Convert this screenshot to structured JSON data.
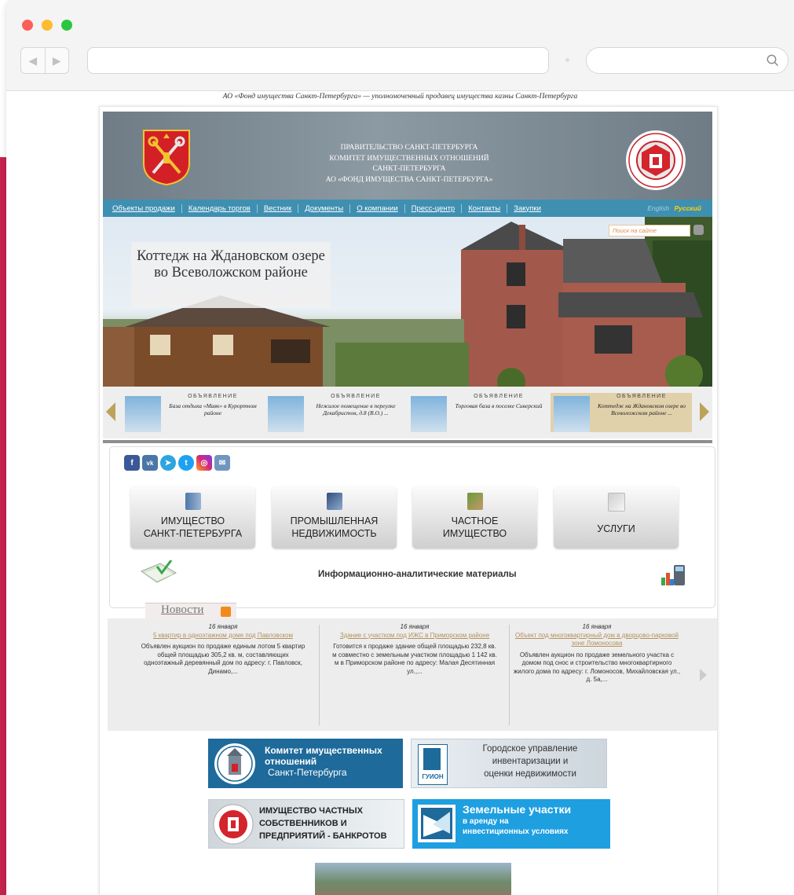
{
  "site": {
    "tagline": "АО «Фонд имущества Санкт-Петербурга» — уполномоченный продавец имущества казны Санкт-Петербурга",
    "header_lines": [
      "ПРАВИТЕЛЬСТВО САНКТ-ПЕТЕРБУРГА",
      "КОМИТЕТ ИМУЩЕСТВЕННЫХ ОТНОШЕНИЙ",
      "САНКТ-ПЕТЕРБУРГА",
      "АО «ФОНД ИМУЩЕСТВА САНКТ-ПЕТЕРБУРГА»"
    ]
  },
  "menu": {
    "items": [
      "Объекты продажи",
      "Календарь торгов",
      "Вестник",
      "Документы",
      "О компании",
      "Пресс-центр",
      "Контакты",
      "Закупки"
    ],
    "lang_en": "English",
    "lang_ru": "Русский"
  },
  "hero": {
    "title": "Коттедж на Ждановском озере во Всеволожском районе",
    "search_placeholder": "Поиск на сайте"
  },
  "carousel": {
    "label": "ОБЪЯВЛЕНИЕ",
    "items": [
      {
        "text": "База отдыха «Маяк» в Курортном районе"
      },
      {
        "text": "Нежилое помещение в переулке Декабристов, д.8 (В.О.) ..."
      },
      {
        "text": "Торговая база в поселке Сиверский"
      },
      {
        "text": "Коттедж на Ждановском озере во Всеволожском районе ..."
      }
    ]
  },
  "social": {
    "icons": [
      "facebook-icon",
      "vk-icon",
      "telegram-icon",
      "twitter-icon",
      "instagram-icon",
      "email-icon"
    ]
  },
  "tiles": [
    {
      "line1": "ИМУЩЕСТВО",
      "line2": "САНКТ-ПЕТЕРБУРГА"
    },
    {
      "line1": "ПРОМЫШЛЕННАЯ",
      "line2": "НЕДВИЖИМОСТЬ"
    },
    {
      "line1": "ЧАСТНОЕ",
      "line2": "ИМУЩЕСТВО"
    },
    {
      "line1": "УСЛУГИ",
      "line2": ""
    }
  ],
  "info": {
    "text": "Информационно-аналитические материалы"
  },
  "news": {
    "title": "Новости",
    "items": [
      {
        "date": "16 января",
        "headline": "5 квартир в одноэтажном доме под Павловском",
        "body": "Объявлен аукцион по продаже единым лотом 5 квартир общей площадью 305,2 кв. м, составляющих одноэтажный деревянный дом по адресу: г. Павловск, Динамо,..."
      },
      {
        "date": "16 января",
        "headline": "Здание с участком под ИЖС в Приморском районе",
        "body": "Готовится к продаже здание общей площадью 232,8 кв. м совместно с земельным участком площадью 1 142 кв. м в Приморском районе по адресу: Малая Десятинная ул.,..."
      },
      {
        "date": "16 января",
        "headline": "Объект под многоквартирный дом в дворцово-парковой зоне Ломоносова",
        "body": "Объявлен аукцион по продаже земельного участка с домом под снос и строительство многоквартирного жилого дома по адресу: г. Ломоносов, Михайловская ул., д. 5а,..."
      }
    ]
  },
  "banners": {
    "kio": {
      "line1": "Комитет имущественных",
      "line2": "отношений",
      "line3": "Санкт-Петербурга"
    },
    "guion": {
      "abbr": "ГУИОН",
      "line1": "Городское управление",
      "line2": "инвентаризации и",
      "line3": "оценки недвижимости"
    },
    "bankrupt": {
      "line1": "ИМУЩЕСТВО ЧАСТНЫХ",
      "line2": "СОБСТВЕННИКОВ И",
      "line3": "ПРЕДПРИЯТИЙ - БАНКРОТОВ"
    },
    "land": {
      "line1": "Земельные участки",
      "line2": "в аренду на",
      "line3": "инвестиционных условиях"
    }
  },
  "colors": {
    "menu_bar": "#3f8fb1",
    "accent_gold": "#bda25b",
    "banner_blue": "#1e6a9a",
    "banner_cyan": "#1e9fe0",
    "pink_strip": "#c4244f"
  }
}
